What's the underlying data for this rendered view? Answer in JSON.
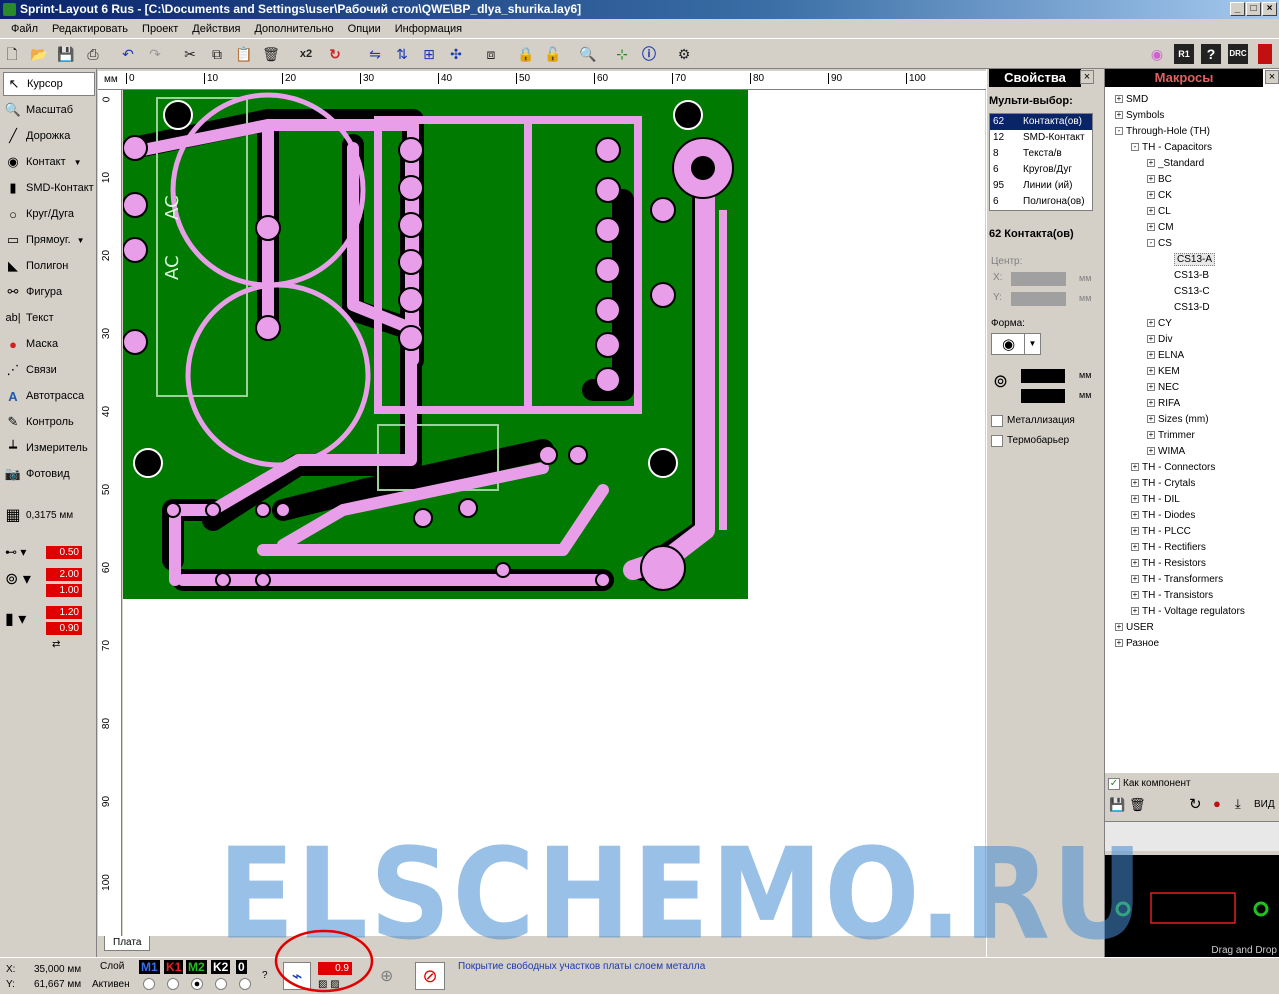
{
  "window": {
    "title": "Sprint-Layout 6 Rus - [C:\\Documents and Settings\\user\\Рабочий стол\\QWE\\BP_dlya_shurika.lay6]"
  },
  "menu": [
    "Файл",
    "Редактировать",
    "Проект",
    "Действия",
    "Дополнительно",
    "Опции",
    "Информация"
  ],
  "toolbar": {
    "multiply_label": "x2",
    "drc_label": "DRC",
    "r1_label": "R1"
  },
  "tools": [
    {
      "label": "Курсор",
      "icon": "cursor-icon"
    },
    {
      "label": "Масштаб",
      "icon": "zoom-icon"
    },
    {
      "label": "Дорожка",
      "icon": "track-icon"
    },
    {
      "label": "Контакт",
      "icon": "pad-icon"
    },
    {
      "label": "SMD-Контакт",
      "icon": "smd-pad-icon"
    },
    {
      "label": "Круг/Дуга",
      "icon": "circle-icon"
    },
    {
      "label": "Прямоуг.",
      "icon": "rectangle-icon"
    },
    {
      "label": "Полигон",
      "icon": "polygon-icon"
    },
    {
      "label": "Фигура",
      "icon": "shape-icon"
    },
    {
      "label": "Текст",
      "icon": "text-icon"
    },
    {
      "label": "Маска",
      "icon": "mask-icon"
    },
    {
      "label": "Связи",
      "icon": "connections-icon"
    },
    {
      "label": "Автотрасса",
      "icon": "autoroute-icon"
    },
    {
      "label": "Контроль",
      "icon": "test-icon"
    },
    {
      "label": "Измеритель",
      "icon": "measure-icon"
    },
    {
      "label": "Фотовид",
      "icon": "photoview-icon"
    }
  ],
  "grid": {
    "value": "0,3175 мм"
  },
  "left_values": [
    "0.50",
    "2.00",
    "1.00",
    "1.20",
    "0.90"
  ],
  "ruler": {
    "unit": "мм",
    "top": [
      "0",
      "10",
      "20",
      "30",
      "40",
      "50",
      "60",
      "70",
      "80",
      "90",
      "100"
    ],
    "left": [
      "0",
      "10",
      "20",
      "30",
      "40",
      "50",
      "60",
      "70",
      "80",
      "90",
      "100"
    ]
  },
  "pcb": {
    "silk_labels": [
      "AC",
      "AC"
    ]
  },
  "tabs": {
    "board": "Плата"
  },
  "properties": {
    "header": "Свойства",
    "multi_label": "Мульти-выбор:",
    "rows": [
      {
        "count": "62",
        "name": "Контакта(ов)"
      },
      {
        "count": "12",
        "name": "SMD-Контакт"
      },
      {
        "count": "8",
        "name": "Текста/в"
      },
      {
        "count": "6",
        "name": "Кругов/Дуг"
      },
      {
        "count": "95",
        "name": "Линии (ий)"
      },
      {
        "count": "6",
        "name": "Полигона(ов)"
      }
    ],
    "selection_title": "62 Контакта(ов)",
    "center_label": "Центр:",
    "x_label": "X:",
    "y_label": "Y:",
    "unit": "мм",
    "shape_label": "Форма:",
    "metallization": "Металлизация",
    "thermobarrier": "Термобарьер"
  },
  "macros": {
    "header": "Макросы",
    "tree": [
      {
        "label": "SMD",
        "level": 0,
        "sign": "+"
      },
      {
        "label": "Symbols",
        "level": 0,
        "sign": "+"
      },
      {
        "label": "Through-Hole (TH)",
        "level": 0,
        "sign": "-"
      },
      {
        "label": "TH - Capacitors",
        "level": 1,
        "sign": "-"
      },
      {
        "label": "_Standard",
        "level": 2,
        "sign": "+"
      },
      {
        "label": "BC",
        "level": 2,
        "sign": "+"
      },
      {
        "label": "CK",
        "level": 2,
        "sign": "+"
      },
      {
        "label": "CL",
        "level": 2,
        "sign": "+"
      },
      {
        "label": "CM",
        "level": 2,
        "sign": "+"
      },
      {
        "label": "CS",
        "level": 2,
        "sign": "-"
      },
      {
        "label": "CS13-A",
        "level": 3,
        "sign": ""
      },
      {
        "label": "CS13-B",
        "level": 3,
        "sign": ""
      },
      {
        "label": "CS13-C",
        "level": 3,
        "sign": ""
      },
      {
        "label": "CS13-D",
        "level": 3,
        "sign": ""
      },
      {
        "label": "CY",
        "level": 2,
        "sign": "+"
      },
      {
        "label": "Div",
        "level": 2,
        "sign": "+"
      },
      {
        "label": "ELNA",
        "level": 2,
        "sign": "+"
      },
      {
        "label": "KEM",
        "level": 2,
        "sign": "+"
      },
      {
        "label": "NEC",
        "level": 2,
        "sign": "+"
      },
      {
        "label": "RIFA",
        "level": 2,
        "sign": "+"
      },
      {
        "label": "Sizes (mm)",
        "level": 2,
        "sign": "+"
      },
      {
        "label": "Trimmer",
        "level": 2,
        "sign": "+"
      },
      {
        "label": "WIMA",
        "level": 2,
        "sign": "+"
      },
      {
        "label": "TH - Connectors",
        "level": 1,
        "sign": "+"
      },
      {
        "label": "TH - Crytals",
        "level": 1,
        "sign": "+"
      },
      {
        "label": "TH - DIL",
        "level": 1,
        "sign": "+"
      },
      {
        "label": "TH - Diodes",
        "level": 1,
        "sign": "+"
      },
      {
        "label": "TH - PLCC",
        "level": 1,
        "sign": "+"
      },
      {
        "label": "TH - Rectifiers",
        "level": 1,
        "sign": "+"
      },
      {
        "label": "TH - Resistors",
        "level": 1,
        "sign": "+"
      },
      {
        "label": "TH - Transformers",
        "level": 1,
        "sign": "+"
      },
      {
        "label": "TH - Transistors",
        "level": 1,
        "sign": "+"
      },
      {
        "label": "TH - Voltage regulators",
        "level": 1,
        "sign": "+"
      },
      {
        "label": "USER",
        "level": 0,
        "sign": "+"
      },
      {
        "label": "Разное",
        "level": 0,
        "sign": "+"
      }
    ],
    "as_component": "Как компонент",
    "view_label": "ВИД",
    "drag_drop": "Drag and Drop"
  },
  "status": {
    "x_label": "X:",
    "x_value": "35,000 мм",
    "y_label": "Y:",
    "y_value": "61,667 мм",
    "layer_label": "Слой",
    "active_label": "Активен",
    "layers": [
      "M1",
      "K1",
      "M2",
      "K2",
      "0"
    ],
    "fill_value": "0.9",
    "hint": "Покрытие свободных участков платы слоем металла"
  },
  "watermark": "ELSCHEMO.RU",
  "colors": {
    "board": "#007a00",
    "copper": "#e89ee8",
    "title_start": "#0a246a",
    "layer_m1": "#3a6ee8",
    "layer_k1": "#e82020",
    "layer_m2": "#20c020"
  }
}
